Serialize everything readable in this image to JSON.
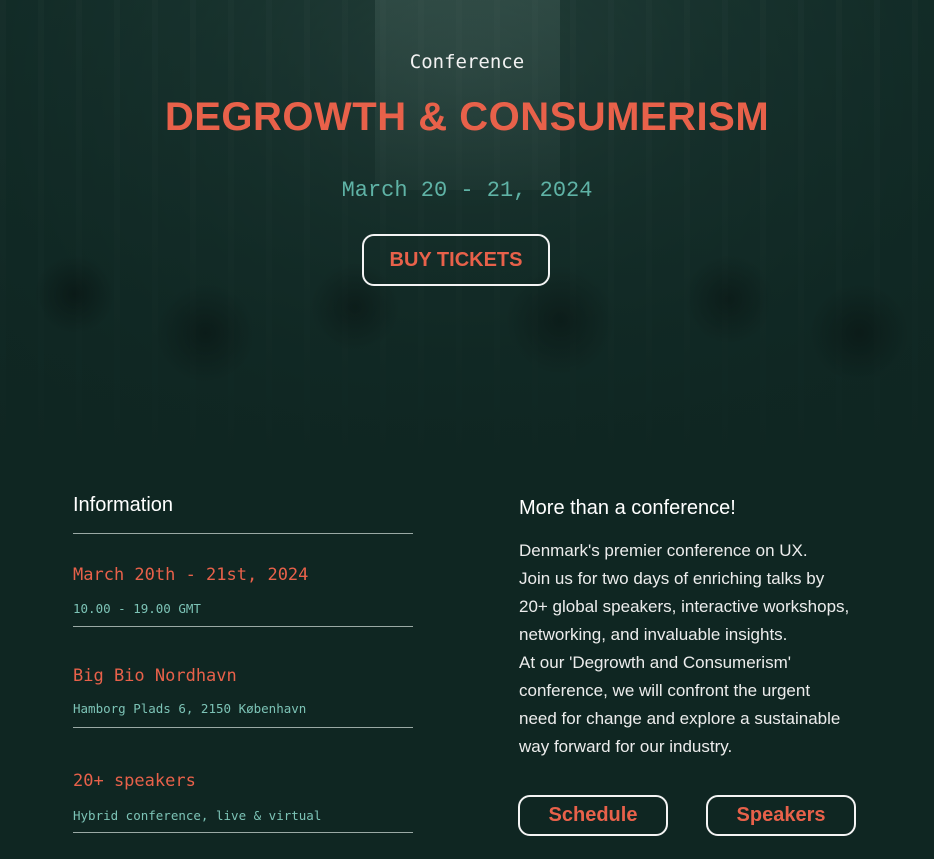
{
  "hero": {
    "eyebrow": "Conference",
    "title": "DEGROWTH & CONSUMERISM",
    "dates": "March 20 - 21, 2024",
    "cta_label": "BUY TICKETS"
  },
  "information": {
    "heading": "Information",
    "items": [
      {
        "title": "March 20th - 21st, 2024",
        "subtitle": "10.00 - 19.00 GMT"
      },
      {
        "title": "Big Bio Nordhavn",
        "subtitle": "Hamborg Plads 6, 2150 København"
      },
      {
        "title": "20+ speakers",
        "subtitle": "Hybrid conference, live & virtual"
      }
    ]
  },
  "about": {
    "heading": "More than a conference!",
    "lines": [
      "Denmark's premier conference on UX.",
      "Join us for two days of enriching talks by",
      "20+ global speakers, interactive workshops,",
      "networking, and invaluable insights.",
      "At our 'Degrowth and Consumerism'",
      "conference, we will confront the urgent",
      "need for change and explore a sustainable",
      "way forward for our industry."
    ],
    "schedule_label": "Schedule",
    "speakers_label": "Speakers"
  },
  "colors": {
    "accent": "#e8614a",
    "teal": "#5fb3a6",
    "background": "#0f2622"
  }
}
